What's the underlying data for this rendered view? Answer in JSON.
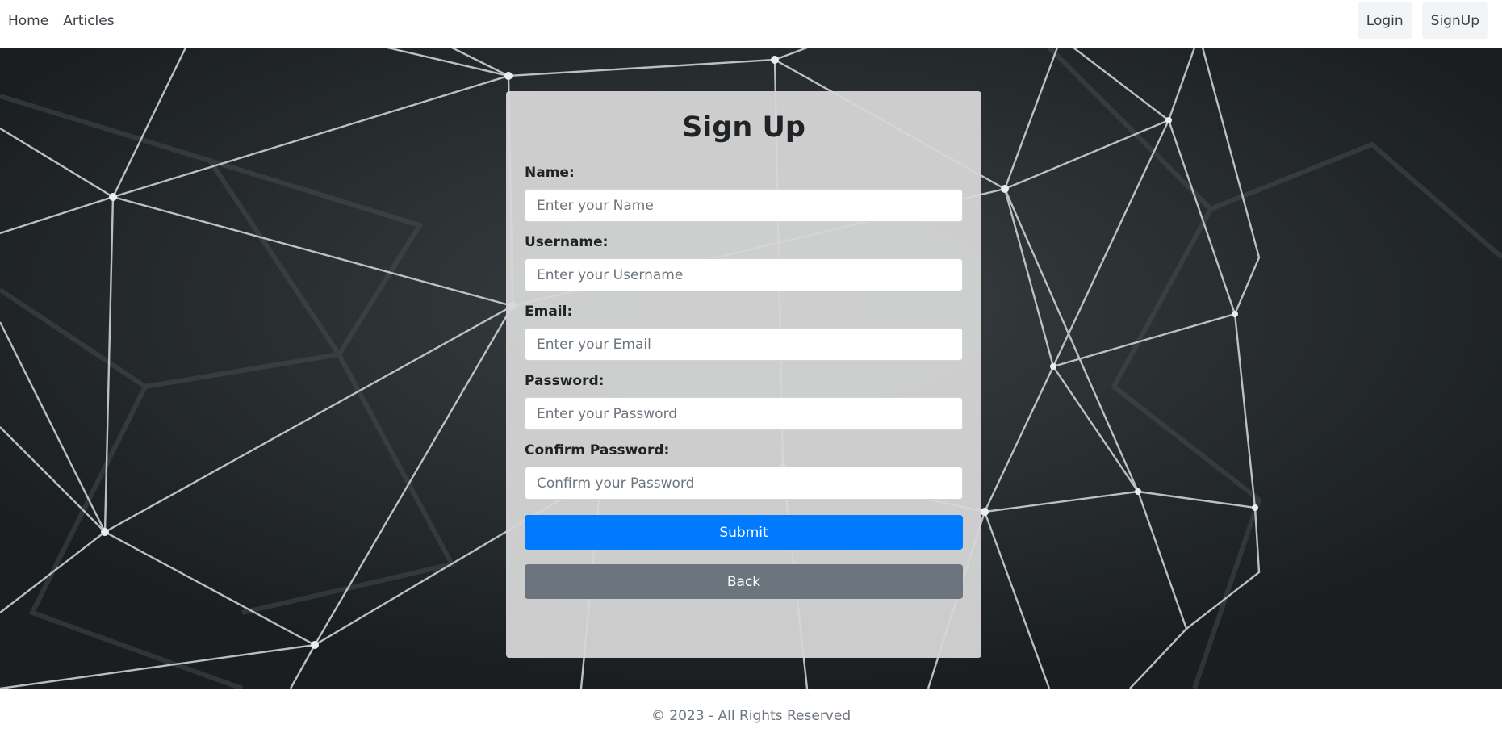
{
  "nav": {
    "links": [
      "Home",
      "Articles"
    ],
    "login_label": "Login",
    "signup_label": "SignUp"
  },
  "form": {
    "title": "Sign Up",
    "fields": [
      {
        "label": "Name:",
        "placeholder": "Enter your Name",
        "value": ""
      },
      {
        "label": "Username:",
        "placeholder": "Enter your Username",
        "value": ""
      },
      {
        "label": "Email:",
        "placeholder": "Enter your Email",
        "value": ""
      },
      {
        "label": "Password:",
        "placeholder": "Enter your Password",
        "value": ""
      },
      {
        "label": "Confirm Password:",
        "placeholder": "Confirm your Password",
        "value": ""
      }
    ],
    "submit_label": "Submit",
    "back_label": "Back"
  },
  "footer": {
    "text": "© 2023 - All Rights Reserved"
  },
  "colors": {
    "primary": "#007bff",
    "secondary": "#6c757d",
    "hero_background": "#1d2224",
    "card_background": "#d6d6d6"
  },
  "icons": [
    "network-mesh-background"
  ]
}
